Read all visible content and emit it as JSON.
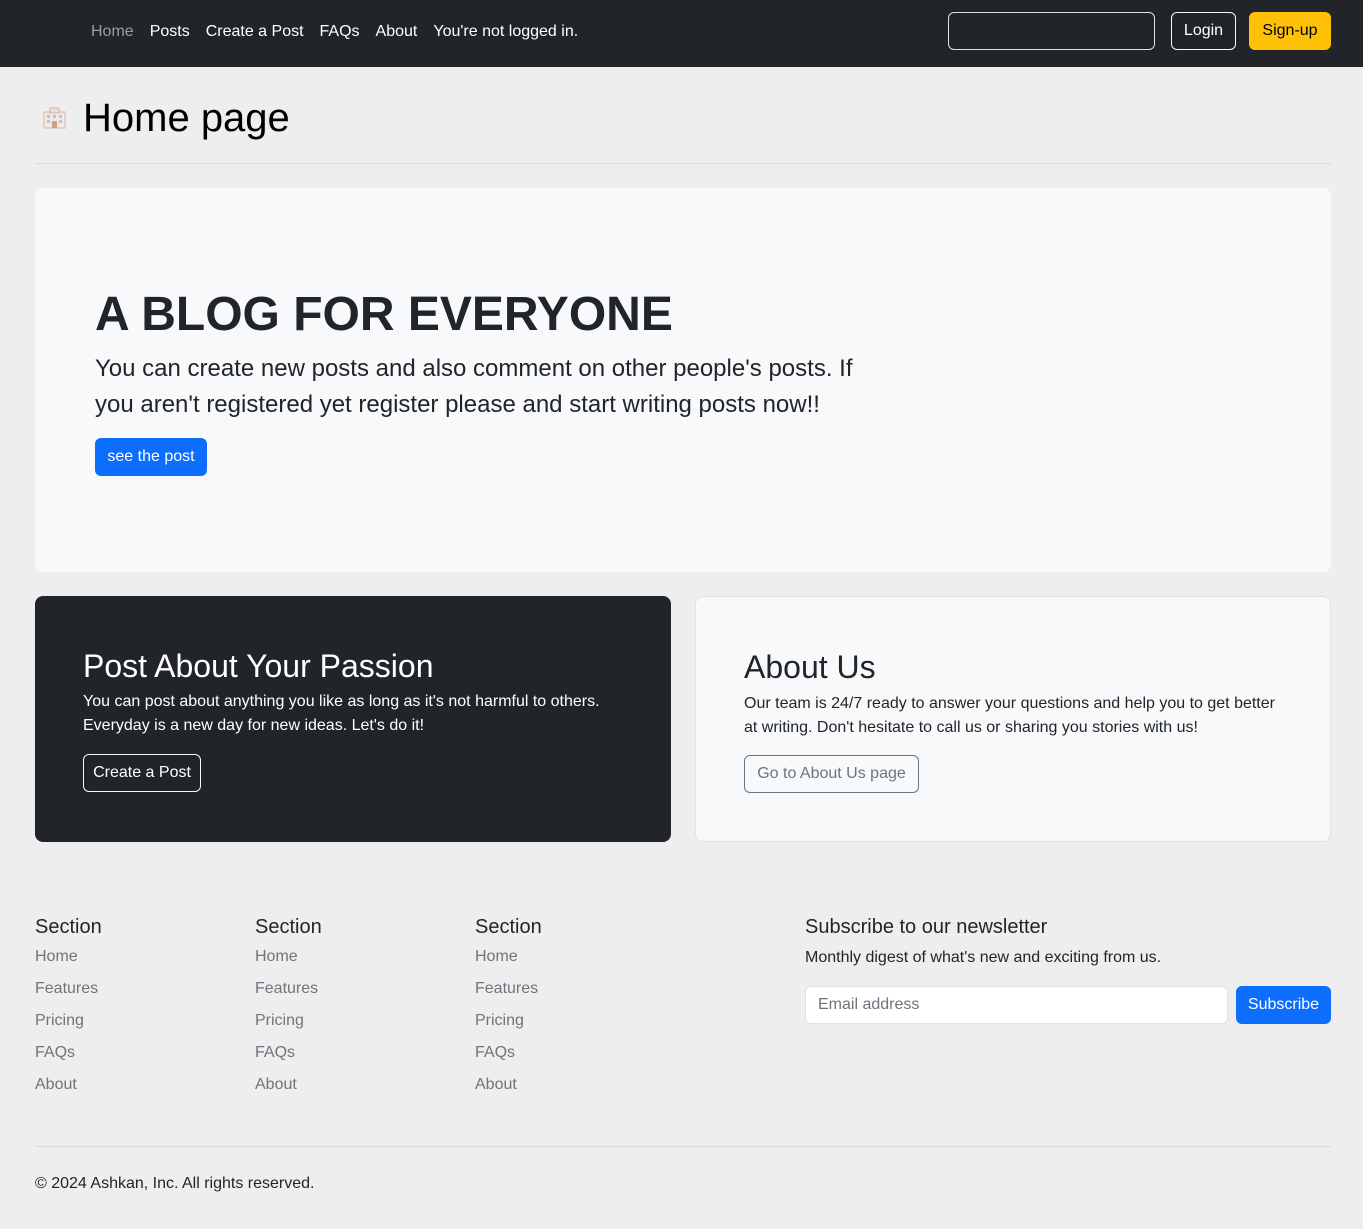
{
  "navbar": {
    "links": [
      "Home",
      "Posts",
      "Create a Post",
      "FAQs",
      "About"
    ],
    "status": "You're not logged in.",
    "search_value": "",
    "login_label": "Login",
    "signup_label": "Sign-up",
    "active_link": "Home",
    "background": "#212529"
  },
  "page": {
    "icon": "building-icon",
    "title": "Home page"
  },
  "hero": {
    "title": "A BLOG FOR EVERYONE",
    "text": "You can create new posts and also comment on other people's posts. If you aren't registered yet register please and start writing posts now!!",
    "button_label": "see the post"
  },
  "cards": {
    "passion": {
      "title": "Post About Your Passion",
      "text": "You can post about anything you like as long as it's not harmful to others. Everyday is a new day for new ideas. Let's do it!",
      "button_label": "Create a Post"
    },
    "about": {
      "title": "About Us",
      "text": "Our team is 24/7 ready to answer your questions and help you to get better at writing. Don't hesitate to call us or sharing you stories with us!",
      "button_label": "Go to About Us page"
    }
  },
  "footer": {
    "sections": [
      {
        "heading": "Section",
        "links": [
          "Home",
          "Features",
          "Pricing",
          "FAQs",
          "About"
        ]
      },
      {
        "heading": "Section",
        "links": [
          "Home",
          "Features",
          "Pricing",
          "FAQs",
          "About"
        ]
      },
      {
        "heading": "Section",
        "links": [
          "Home",
          "Features",
          "Pricing",
          "FAQs",
          "About"
        ]
      }
    ],
    "newsletter": {
      "title": "Subscribe to our newsletter",
      "text": "Monthly digest of what's new and exciting from us.",
      "email_placeholder": "Email address",
      "button_label": "Subscribe"
    },
    "copyright": "© 2024 Ashkan, Inc. All rights reserved."
  },
  "colors": {
    "primary": "#0d6efd",
    "warning": "#ffc107",
    "dark": "#212529",
    "light": "#f8f9fa",
    "page_bg": "#eeeeee"
  }
}
